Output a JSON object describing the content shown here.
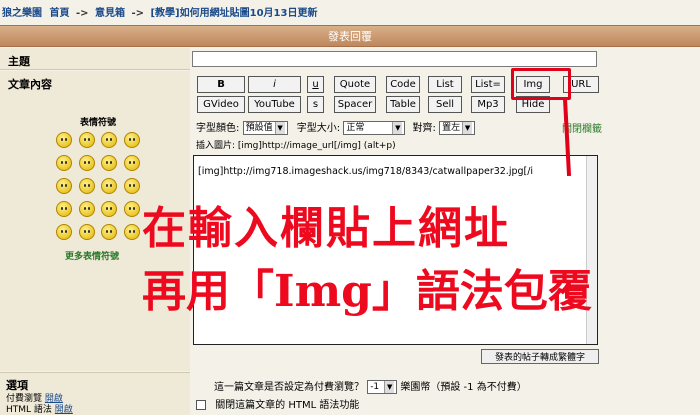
{
  "breadcrumb": {
    "site": "狼之樂園",
    "home": "首頁",
    "forum": "意見箱",
    "topic": "[教學]如何用網址貼圖10月13日更新",
    "separator": "->"
  },
  "header": {
    "title": "發表回覆"
  },
  "subject": {
    "label": "主題",
    "value": ""
  },
  "content": {
    "label": "文章內容"
  },
  "toolbar": {
    "row1": [
      "B",
      "i",
      "u",
      "Quote",
      "Code",
      "List",
      "List=",
      "Img",
      "URL"
    ],
    "row2": [
      "GVideo",
      "YouTube",
      "s",
      "Spacer",
      "Table",
      "Sell",
      "Mp3",
      "Hide"
    ]
  },
  "format": {
    "font_color_label": "字型顏色:",
    "font_color_value": "預設值",
    "font_size_label": "字型大小:",
    "font_size_value": "正常",
    "align_label": "對齊:",
    "align_value": "置左",
    "close_toolbar": "關閉欄籤"
  },
  "img_hint": "插入圖片: [img]http://image_url[/img]  (alt+p)",
  "textarea": {
    "value": "[img]http://img718.imageshack.us/img718/8343/catwallpaper32.jpg[/i"
  },
  "smileys": {
    "title": "表情符號",
    "more": "更多表情符號"
  },
  "annotation": {
    "line1": "在輸入欄貼上網址",
    "line2": "再用「Img」語法包覆",
    "color": "#ee0a1e"
  },
  "convert_button": "發表的帖子轉成繁體字",
  "options": {
    "label": "選項",
    "paid_view_label": "付費瀏覽",
    "paid_view_status": "開啟",
    "html_label": "HTML 語法",
    "html_status": "開啟",
    "paid_question": "這一篇文章是否設定為付費瀏覽？",
    "paid_value": "-1",
    "paid_suffix": "樂園幣（預設 -1 為不付費）",
    "disable_html": "關閉這篇文章的 HTML 語法功能"
  }
}
